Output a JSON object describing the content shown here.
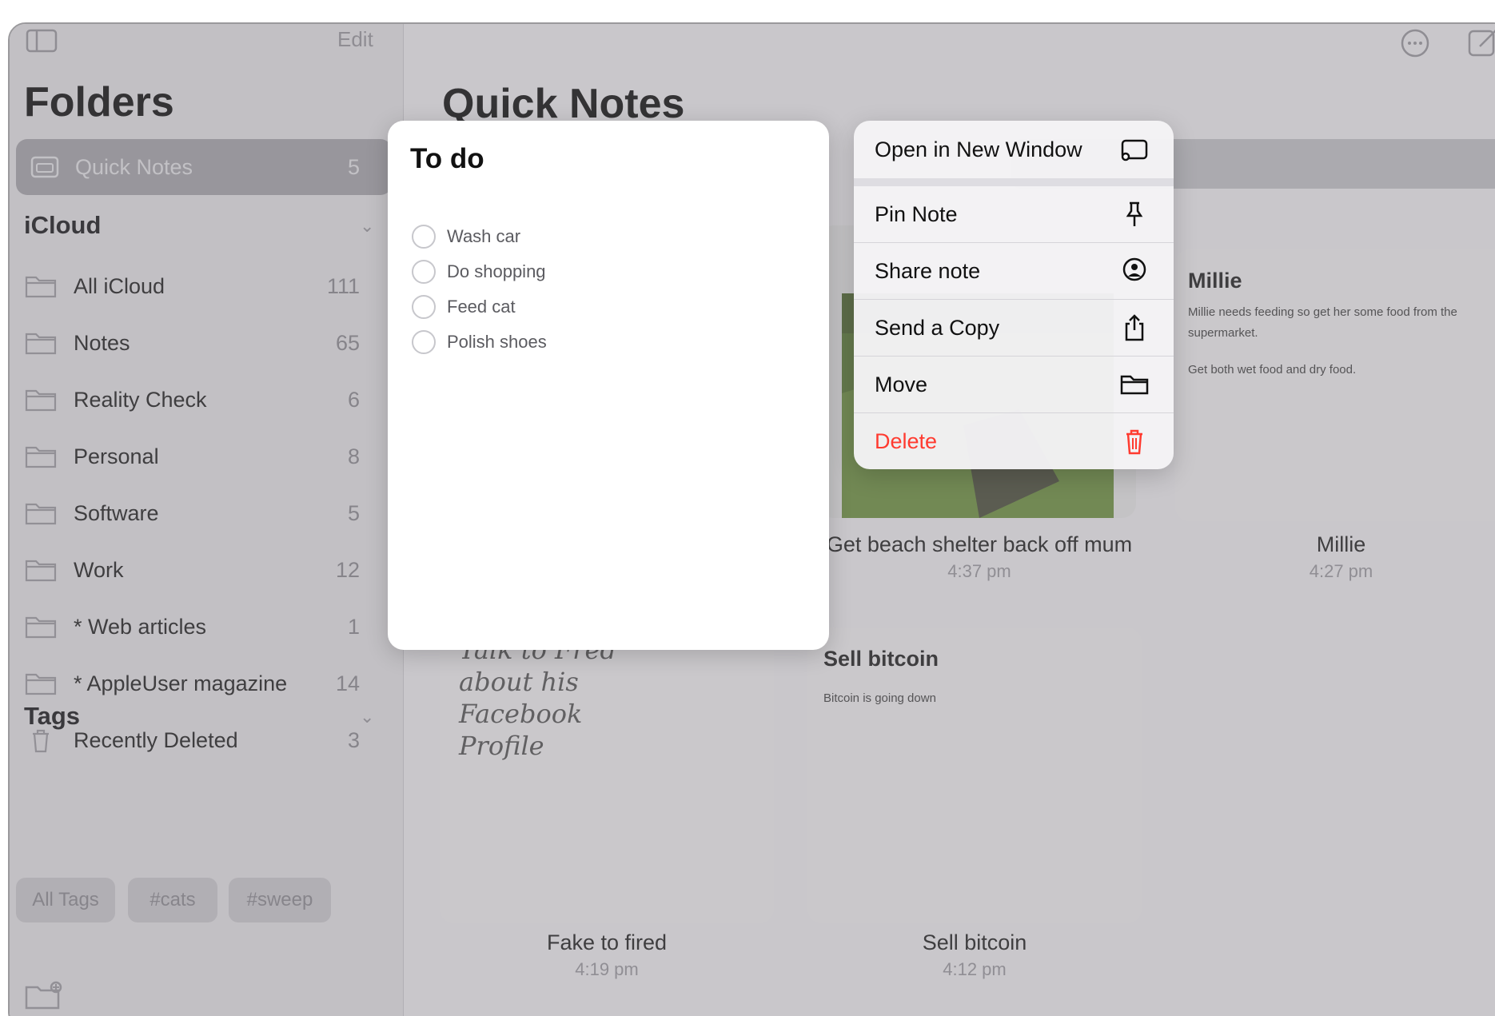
{
  "sidebar": {
    "edit": "Edit",
    "title": "Folders",
    "quick_notes": {
      "label": "Quick Notes",
      "count": "5"
    },
    "icloud_header": "iCloud",
    "folders": [
      {
        "label": "All iCloud",
        "count": "111"
      },
      {
        "label": "Notes",
        "count": "65"
      },
      {
        "label": "Reality Check",
        "count": "6"
      },
      {
        "label": "Personal",
        "count": "8"
      },
      {
        "label": "Software",
        "count": "5"
      },
      {
        "label": "Work",
        "count": "12"
      },
      {
        "label": "* Web articles",
        "count": "1"
      },
      {
        "label": "* AppleUser magazine",
        "count": "14"
      },
      {
        "label": "Recently Deleted",
        "count": "3"
      }
    ],
    "tags_header": "Tags",
    "tags": [
      "All Tags",
      "#cats",
      "#sweep"
    ]
  },
  "main": {
    "title": "Quick Notes",
    "cards": [
      {
        "label": "Get beach shelter back off mum",
        "time": "4:37 pm"
      },
      {
        "label": "Millie",
        "time": "4:27 pm",
        "heading": "Millie",
        "body1": "Millie needs feeding so get her some food from the supermarket.",
        "body2": "Get both wet food and dry food."
      },
      {
        "label": "Fake to fired",
        "time": "4:19 pm",
        "handwriting": [
          "Talk to Fred",
          "about his",
          "Facebook",
          "Profile"
        ]
      },
      {
        "label": "Sell bitcoin",
        "time": "4:12 pm",
        "heading": "Sell bitcoin",
        "body1": "Bitcoin is going down"
      }
    ]
  },
  "preview": {
    "title": "To do",
    "items": [
      "Wash car",
      "Do shopping",
      "Feed cat",
      "Polish shoes"
    ]
  },
  "menu": {
    "items": [
      {
        "label": "Open in New Window",
        "icon": "new-window-icon"
      },
      {
        "label": "Pin Note",
        "icon": "pin-icon"
      },
      {
        "label": "Share note",
        "icon": "share-person-icon"
      },
      {
        "label": "Send a Copy",
        "icon": "share-icon"
      },
      {
        "label": "Move",
        "icon": "folder-icon"
      },
      {
        "label": "Delete",
        "icon": "trash-icon"
      }
    ],
    "delete_color": "#ff3b30"
  }
}
